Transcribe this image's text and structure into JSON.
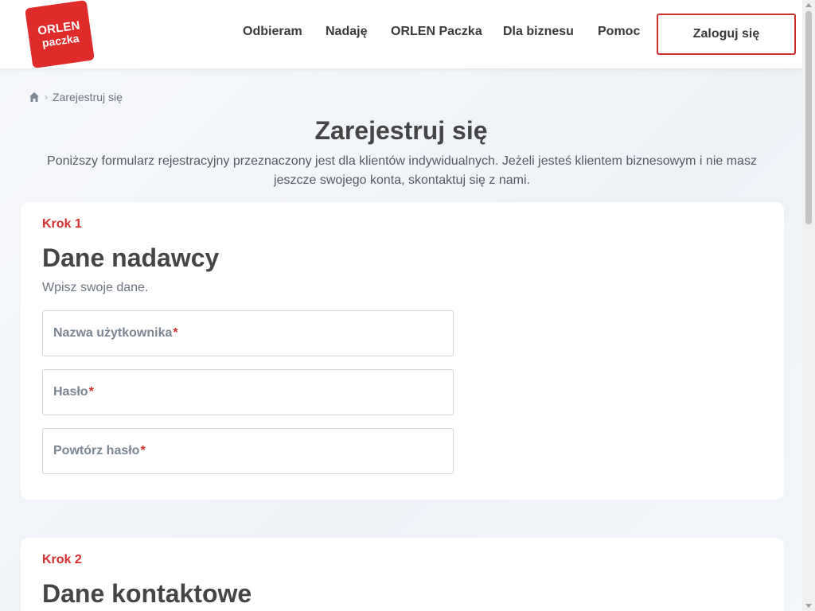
{
  "header": {
    "logo_line1": "ORLEN",
    "logo_line2": "paczka",
    "nav": [
      "Odbieram",
      "Nadaję",
      "ORLEN Paczka",
      "Dla biznesu",
      "Pomoc"
    ],
    "login_label": "Zaloguj się"
  },
  "breadcrumb": {
    "home_icon": "home-icon",
    "current": "Zarejestruj się"
  },
  "page": {
    "title": "Zarejestruj się",
    "intro": "Poniższy formularz rejestracyjny przeznaczony jest dla klientów indywidualnych. Jeżeli jesteś klientem biznesowym i nie masz jeszcze swojego konta, skontaktuj się z nami."
  },
  "step1": {
    "label": "Krok 1",
    "title": "Dane nadawcy",
    "subtitle": "Wpisz swoje dane.",
    "fields": [
      {
        "label": "Nazwa użytkownika",
        "required_mark": "*"
      },
      {
        "label": "Hasło",
        "required_mark": "*"
      },
      {
        "label": "Powtórz hasło",
        "required_mark": "*"
      }
    ]
  },
  "step2": {
    "label": "Krok 2",
    "title": "Dane kontaktowe"
  },
  "colors": {
    "brand_red": "#e02b2b",
    "required_red": "#d32f2f"
  }
}
